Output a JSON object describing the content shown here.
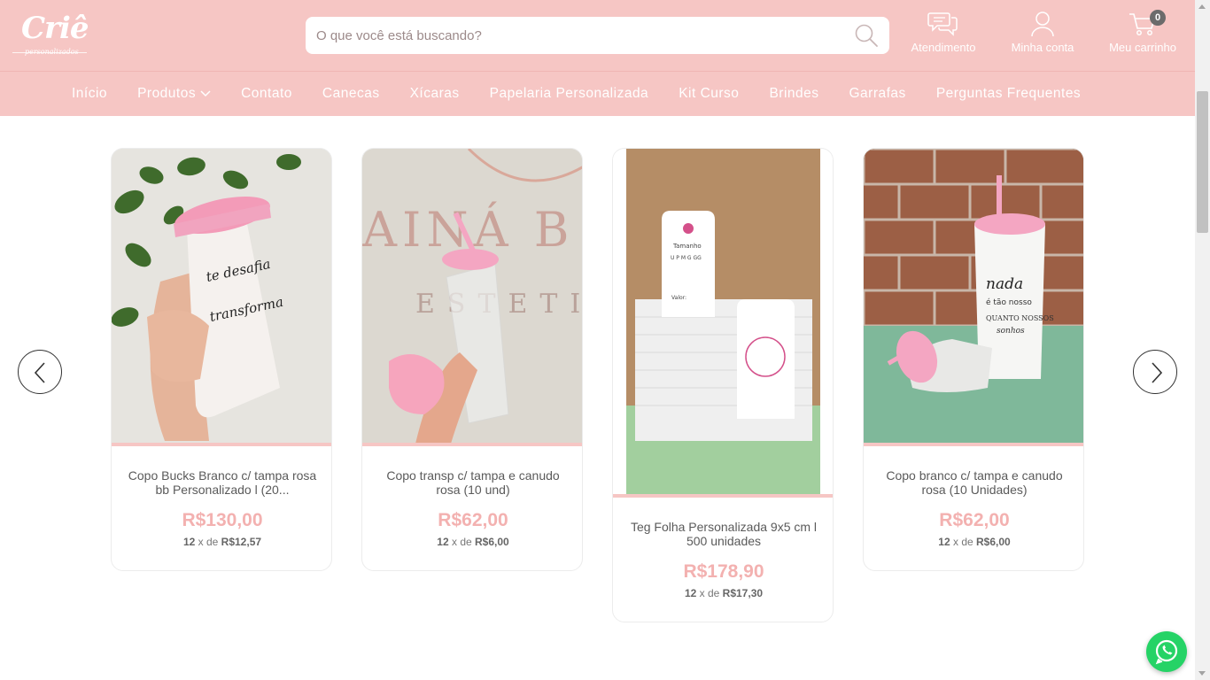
{
  "header": {
    "logo_text": "Criê",
    "logo_subtext": "personalizados",
    "search_placeholder": "O que você está buscando?",
    "atendimento_label": "Atendimento",
    "account_label": "Minha conta",
    "cart_label": "Meu carrinho",
    "cart_count": "0"
  },
  "nav": {
    "items": [
      {
        "label": "Início"
      },
      {
        "label": "Produtos"
      },
      {
        "label": "Contato"
      },
      {
        "label": "Canecas"
      },
      {
        "label": "Xícaras"
      },
      {
        "label": "Papelaria Personalizada"
      },
      {
        "label": "Kit Curso"
      },
      {
        "label": "Brindes"
      },
      {
        "label": "Garrafas"
      },
      {
        "label": "Perguntas Frequentes"
      }
    ]
  },
  "products": [
    {
      "name": "Copo Bucks Branco c/ tampa rosa bb Personalizado l (20...",
      "price": "R$130,00",
      "installments": "12",
      "installment_sep": "x de",
      "installment_value": "R$12,57"
    },
    {
      "name": "Copo transp c/ tampa e canudo rosa (10 und)",
      "price": "R$62,00",
      "installments": "12",
      "installment_sep": "x de",
      "installment_value": "R$6,00"
    },
    {
      "name": "Teg Folha Personalizada 9x5 cm l 500 unidades",
      "price": "R$178,90",
      "installments": "12",
      "installment_sep": "x de",
      "installment_value": "R$17,30"
    },
    {
      "name": "Copo branco c/ tampa e canudo rosa (10 Unidades)",
      "price": "R$62,00",
      "installments": "12",
      "installment_sep": "x de",
      "installment_value": "R$6,00"
    }
  ],
  "image_text": {
    "p1_cup_text": "te desafia / transforma",
    "p2_wall_text": "AINÁ B / ESTÉTIC",
    "p3_tag_title": "Tamanho",
    "p3_tag_sizes": "U P M G GG",
    "p3_tag_value": "Valor:",
    "p4_cup_text": "nada é tão nosso quanto nossos sonhos"
  },
  "colors": {
    "brand_pink": "#f6c6c4",
    "price_pink": "#f3b1b0",
    "whatsapp_green": "#25d366"
  }
}
